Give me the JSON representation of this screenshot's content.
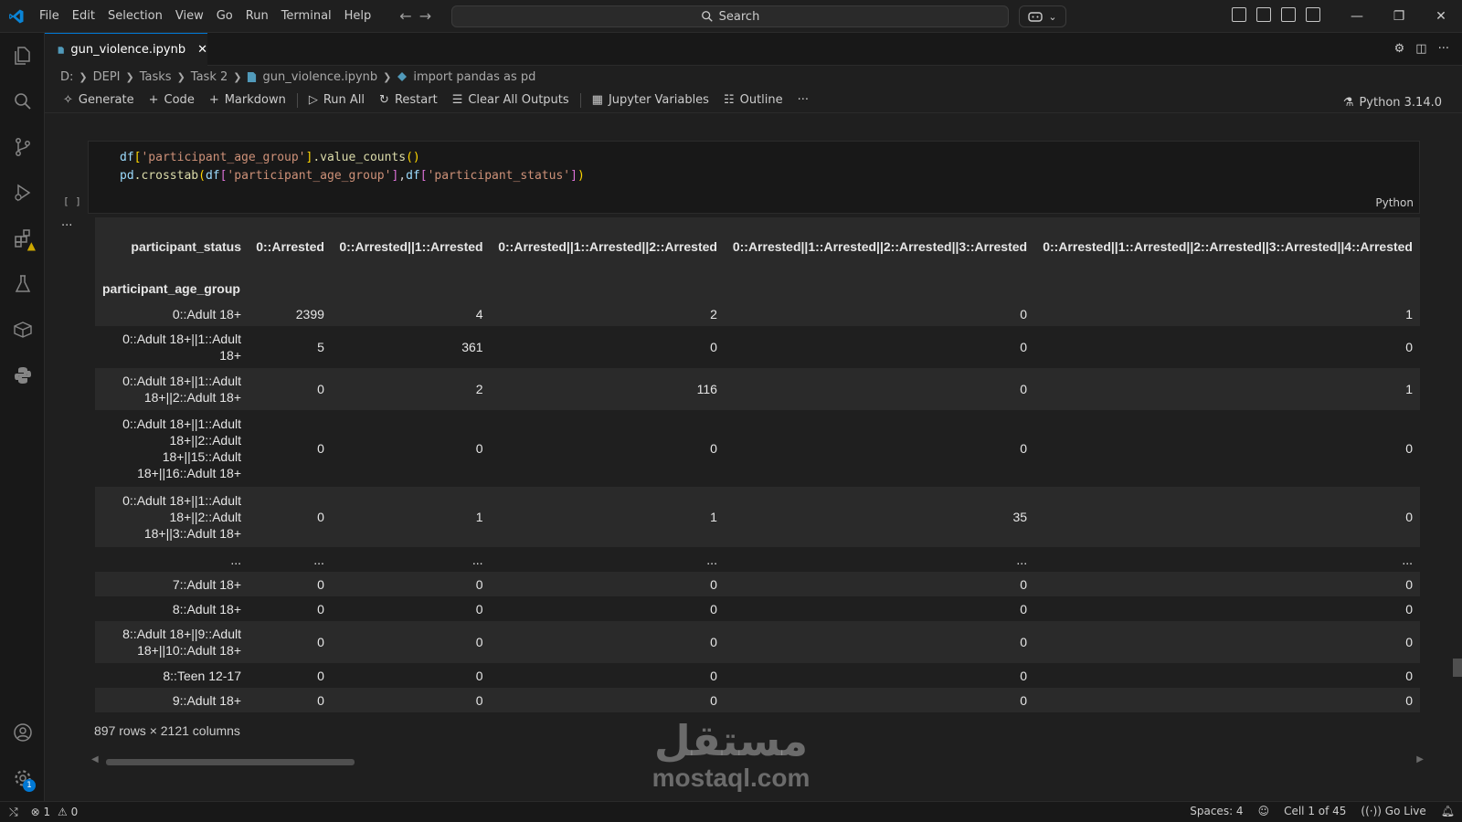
{
  "menu": [
    "File",
    "Edit",
    "Selection",
    "View",
    "Go",
    "Run",
    "Terminal",
    "Help"
  ],
  "search": {
    "label": "Search"
  },
  "tab": {
    "filename": "gun_violence.ipynb"
  },
  "breadcrumb": [
    "D:",
    "DEPI",
    "Tasks",
    "Task 2",
    "gun_violence.ipynb",
    "import pandas as pd"
  ],
  "toolbar": {
    "generate": "Generate",
    "code": "Code",
    "markdown": "Markdown",
    "run_all": "Run All",
    "restart": "Restart",
    "clear_outputs": "Clear All Outputs",
    "jupyter_vars": "Jupyter Variables",
    "outline": "Outline",
    "more": "···",
    "kernel": "Python 3.14.0"
  },
  "cell": {
    "line1": [
      "df",
      "[",
      "'participant_age_group'",
      "]",
      ".value_counts",
      "()"
    ],
    "line2": [
      "pd",
      ".crosstab",
      "(",
      "df",
      "[",
      "'participant_age_group'",
      "]",
      ",",
      "df",
      "[",
      "'participant_status'",
      "]",
      ")"
    ],
    "language": "Python",
    "exec_bracket": "[ ]",
    "output_more": "..."
  },
  "dataframe": {
    "columns_name": "participant_status",
    "index_name": "participant_age_group",
    "columns": [
      "0::Arrested",
      "0::Arrested||1::Arrested",
      "0::Arrested||1::Arrested||2::Arrested",
      "0::Arrested||1::Arrested||2::Arrested||3::Arrested",
      "0::Arrested||1::Arrested||2::Arrested||3::Arrested||4::Arrested"
    ],
    "rows": [
      {
        "index": "0::Adult 18+",
        "values": [
          "2399",
          "4",
          "2",
          "0",
          "1"
        ]
      },
      {
        "index": "0::Adult 18+||1::Adult 18+",
        "values": [
          "5",
          "361",
          "0",
          "0",
          "0"
        ]
      },
      {
        "index": "0::Adult 18+||1::Adult 18+||2::Adult 18+",
        "values": [
          "0",
          "2",
          "116",
          "0",
          "1"
        ]
      },
      {
        "index": "0::Adult 18+||1::Adult 18+||2::Adult 18+||15::Adult 18+||16::Adult 18+",
        "values": [
          "0",
          "0",
          "0",
          "0",
          "0"
        ]
      },
      {
        "index": "0::Adult 18+||1::Adult 18+||2::Adult 18+||3::Adult 18+",
        "values": [
          "0",
          "1",
          "1",
          "35",
          "0"
        ]
      },
      {
        "index": "...",
        "values": [
          "...",
          "...",
          "...",
          "...",
          "..."
        ]
      },
      {
        "index": "7::Adult 18+",
        "values": [
          "0",
          "0",
          "0",
          "0",
          "0"
        ]
      },
      {
        "index": "8::Adult 18+",
        "values": [
          "0",
          "0",
          "0",
          "0",
          "0"
        ]
      },
      {
        "index": "8::Adult 18+||9::Adult 18+||10::Adult 18+",
        "values": [
          "0",
          "0",
          "0",
          "0",
          "0"
        ]
      },
      {
        "index": "8::Teen 12-17",
        "values": [
          "0",
          "0",
          "0",
          "0",
          "0"
        ]
      },
      {
        "index": "9::Adult 18+",
        "values": [
          "0",
          "0",
          "0",
          "0",
          "0"
        ]
      }
    ],
    "shape": "897 rows × 2121 columns"
  },
  "watermark": {
    "arabic": "مستقل",
    "latin": "mostaql.com"
  },
  "status": {
    "errors": "1",
    "warnings": "0",
    "spaces": "Spaces: 4",
    "cell_position": "Cell 1 of 45",
    "go_live": "Go Live"
  },
  "activity": {
    "settings_badge": "1"
  },
  "colors": {
    "accent": "#0078d4",
    "background": "#1f1f1f",
    "warning": "#cca700"
  }
}
